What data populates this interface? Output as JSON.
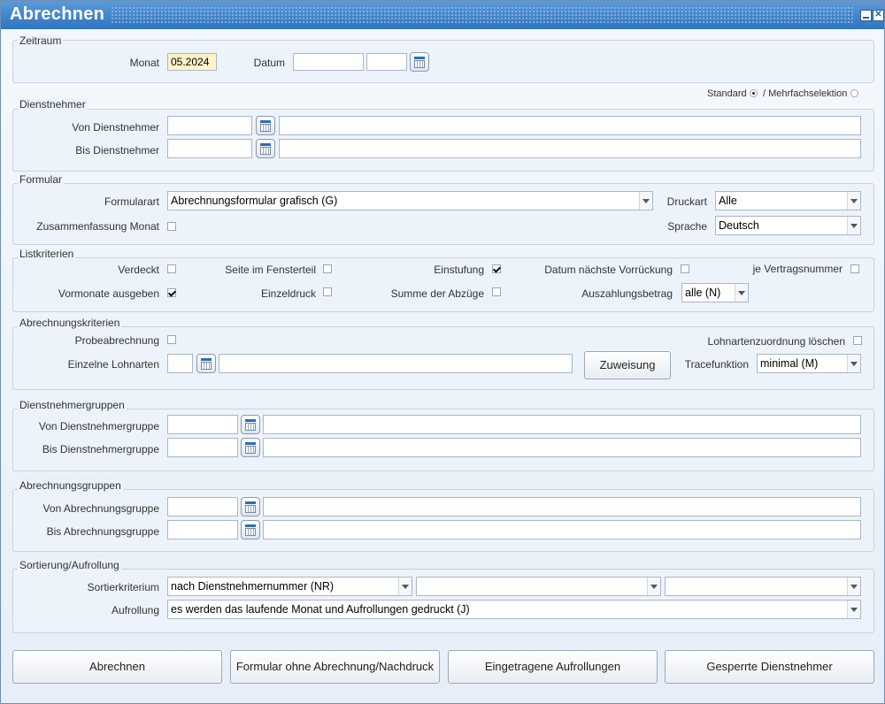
{
  "window": {
    "title": "Abrechnen"
  },
  "zeitraum": {
    "legend": "Zeitraum",
    "monat_label": "Monat",
    "monat_value": "05.2024",
    "datum_label": "Datum",
    "datum_value1": "",
    "datum_value2": ""
  },
  "selection": {
    "standard_label": "Standard",
    "mehrfach_label": "/ Mehrfachselektion",
    "selected": "Standard"
  },
  "dienstnehmer": {
    "legend": "Dienstnehmer",
    "von_label": "Von Dienstnehmer",
    "von_value": "",
    "von_desc": "",
    "bis_label": "Bis Dienstnehmer",
    "bis_value": "",
    "bis_desc": ""
  },
  "formular": {
    "legend": "Formular",
    "formularart_label": "Formularart",
    "formularart_value": "Abrechnungsformular grafisch (G)",
    "druckart_label": "Druckart",
    "druckart_value": "Alle",
    "zusammenfassung_label": "Zusammenfassung Monat",
    "sprache_label": "Sprache",
    "sprache_value": "Deutsch"
  },
  "listkriterien": {
    "legend": "Listkriterien",
    "verdeckt": "Verdeckt",
    "seite": "Seite im Fensterteil",
    "einstufung": "Einstufung",
    "datum_vorrueckung": "Datum nächste Vorrückung",
    "je_vertragsnummer": "je Vertragsnummer",
    "vormonate": "Vormonate ausgeben",
    "einzeldruck": "Einzeldruck",
    "summe_abzuege": "Summe der Abzüge",
    "auszahlungsbetrag_label": "Auszahlungsbetrag",
    "auszahlungsbetrag_value": "alle (N)"
  },
  "abrechnungskriterien": {
    "legend": "Abrechnungskriterien",
    "probeabrechnung": "Probeabrechnung",
    "lohnarten_loeschen": "Lohnartenzuordnung löschen",
    "einzelne_lohnarten_label": "Einzelne Lohnarten",
    "einzelne_lohnarten_value": "",
    "einzelne_lohnarten_desc": "",
    "zuweisung_button": "Zuweisung",
    "tracefunktion_label": "Tracefunktion",
    "tracefunktion_value": "minimal (M)"
  },
  "dienstnehmergruppen": {
    "legend": "Dienstnehmergruppen",
    "von_label": "Von Dienstnehmergruppe",
    "von_value": "",
    "von_desc": "",
    "bis_label": "Bis Dienstnehmergruppe",
    "bis_value": "",
    "bis_desc": ""
  },
  "abrechnungsgruppen": {
    "legend": "Abrechnungsgruppen",
    "von_label": "Von Abrechnungsgruppe",
    "von_value": "",
    "von_desc": "",
    "bis_label": "Bis Abrechnungsgruppe",
    "bis_value": "",
    "bis_desc": ""
  },
  "sortierung": {
    "legend": "Sortierung/Aufrollung",
    "kriterium_label": "Sortierkriterium",
    "kriterium_value1": "nach Dienstnehmernummer (NR)",
    "kriterium_value2": "",
    "kriterium_value3": "",
    "aufrollung_label": "Aufrollung",
    "aufrollung_value": "es werden das laufende Monat und Aufrollungen gedruckt (J)"
  },
  "buttons": {
    "abrechnen": "Abrechnen",
    "formular_ohne": "Formular ohne Abrechnung/Nachdruck",
    "eingetragene": "Eingetragene Aufrollungen",
    "gesperrte": "Gesperrte Dienstnehmer"
  },
  "checks": {
    "zusammenfassung": false,
    "verdeckt": false,
    "seite": false,
    "einstufung": true,
    "datum_vorrueckung": false,
    "je_vertragsnummer": false,
    "vormonate": true,
    "einzeldruck": false,
    "summe_abzuege": false,
    "probeabrechnung": false,
    "lohnarten_loeschen": false
  }
}
